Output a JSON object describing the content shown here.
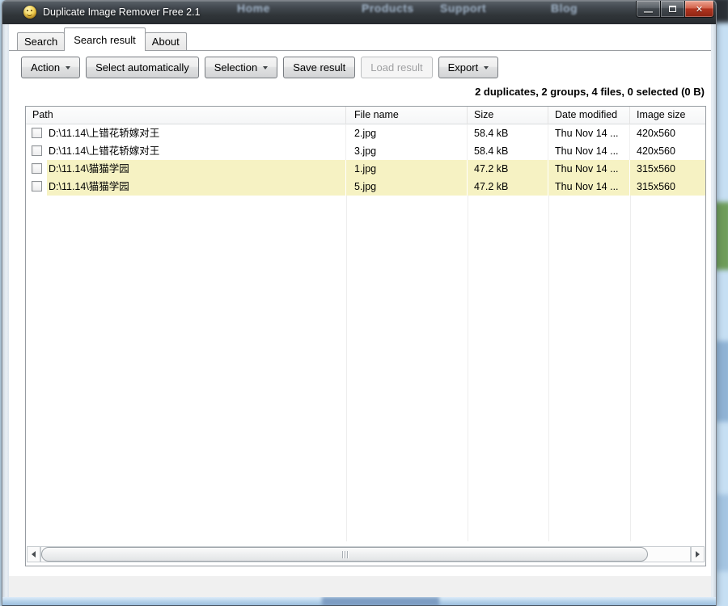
{
  "window": {
    "title": "Duplicate Image Remover Free 2.1",
    "app_icon": "smiley-face-icon",
    "controls": [
      {
        "name": "minimize",
        "glyph": "—"
      },
      {
        "name": "maximize",
        "glyph": ""
      },
      {
        "name": "close",
        "glyph": "✕"
      }
    ]
  },
  "background": {
    "nav_items": [
      "Home",
      "Products",
      "Support",
      "Blog"
    ]
  },
  "tabs": [
    {
      "label": "Search",
      "active": false
    },
    {
      "label": "Search result",
      "active": true
    },
    {
      "label": "About",
      "active": false
    }
  ],
  "toolbar": {
    "buttons": [
      {
        "label": "Action",
        "dropdown": true,
        "disabled": false
      },
      {
        "label": "Select automatically",
        "dropdown": false,
        "disabled": false
      },
      {
        "label": "Selection",
        "dropdown": true,
        "disabled": false
      },
      {
        "label": "Save result",
        "dropdown": false,
        "disabled": false
      },
      {
        "label": "Load result",
        "dropdown": false,
        "disabled": true
      },
      {
        "label": "Export",
        "dropdown": true,
        "disabled": false
      }
    ]
  },
  "status": {
    "summary": "2 duplicates, 2 groups, 4 files, 0 selected (0 B)"
  },
  "table": {
    "columns": [
      "Path",
      "File name",
      "Size",
      "Date modified",
      "Image size"
    ],
    "rows": [
      {
        "checked": false,
        "path": "D:\\11.14\\上错花轿嫁对王",
        "file_name": "2.jpg",
        "size": "58.4 kB",
        "date_modified": "Thu Nov 14 ...",
        "image_size": "420x560",
        "highlight": false
      },
      {
        "checked": false,
        "path": "D:\\11.14\\上错花轿嫁对王",
        "file_name": "3.jpg",
        "size": "58.4 kB",
        "date_modified": "Thu Nov 14 ...",
        "image_size": "420x560",
        "highlight": false
      },
      {
        "checked": false,
        "path": "D:\\11.14\\猫猫学园",
        "file_name": "1.jpg",
        "size": "47.2 kB",
        "date_modified": "Thu Nov 14 ...",
        "image_size": "315x560",
        "highlight": true
      },
      {
        "checked": false,
        "path": "D:\\11.14\\猫猫学园",
        "file_name": "5.jpg",
        "size": "47.2 kB",
        "date_modified": "Thu Nov 14 ...",
        "image_size": "315x560",
        "highlight": true
      }
    ]
  },
  "icons": {
    "dropdown": "triangle-down",
    "scroll_left": "triangle-left",
    "scroll_right": "triangle-right",
    "thumb_grip": "grip-bars"
  },
  "colors": {
    "row_highlight": "#F6F2C3",
    "close_button_red": "#B23520",
    "title_bar_dark": "#303539"
  }
}
